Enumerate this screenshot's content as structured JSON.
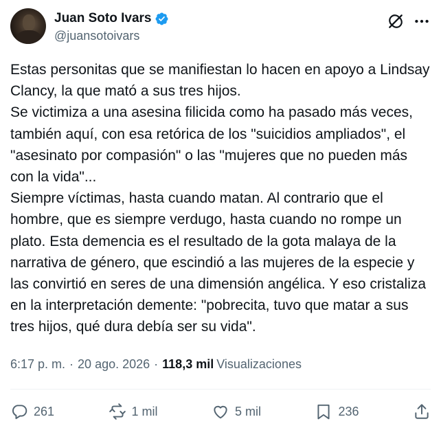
{
  "author": {
    "name": "Juan Soto Ivars",
    "handle": "@juansotoivars",
    "verified": true
  },
  "tweet": {
    "text": "Estas personitas que se manifiestan lo hacen en apoyo a Lindsay Clancy, la que mató a sus tres hijos.\nSe victimiza a una asesina filicida como ha pasado más veces, también aquí, con esa retórica de los \"suicidios ampliados\", el \"asesinato por compasión\" o las \"mujeres que no pueden más con la vida\"...\nSiempre víctimas, hasta cuando matan. Al contrario que el hombre, que es siempre verdugo, hasta cuando no rompe un plato. Esta demencia es el resultado de la gota malaya de la narrativa de género, que escindió a las mujeres de la especie y las convirtió en seres de una dimensión angélica. Y eso cristaliza en la interpretación demente: \"pobrecita, tuvo que matar a sus tres hijos, qué dura debía ser su vida\"."
  },
  "meta": {
    "time": "6:17 p. m.",
    "separator": "·",
    "date": "20 ago. 2026",
    "views_count": "118,3 mil",
    "views_label": "Visualizaciones"
  },
  "actions": {
    "replies": "261",
    "reposts": "1 mil",
    "likes": "5 mil",
    "bookmarks": "236"
  },
  "colors": {
    "text_primary": "#0f1419",
    "text_secondary": "#536471",
    "verified_blue": "#1d9bf0",
    "divider": "#eff3f4"
  },
  "icons": [
    "verified-badge-icon",
    "grok-icon",
    "more-icon",
    "reply-icon",
    "repost-icon",
    "like-icon",
    "bookmark-icon",
    "share-icon"
  ]
}
